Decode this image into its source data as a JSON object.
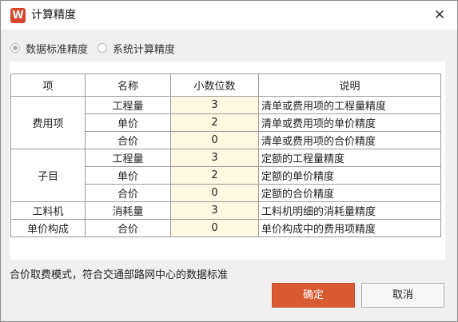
{
  "dialog": {
    "title": "计算精度",
    "app_icon_letter": "W",
    "close_glyph": "✕"
  },
  "options": [
    {
      "label": "数据标准精度",
      "checked": true
    },
    {
      "label": "系统计算精度",
      "checked": false
    }
  ],
  "table": {
    "headers": [
      "项",
      "名称",
      "小数位数",
      "说明"
    ],
    "groups": [
      {
        "item": "费用项",
        "rows": [
          {
            "name": "工程量",
            "digits": "3",
            "desc": "清单或费用项的工程量精度"
          },
          {
            "name": "单价",
            "digits": "2",
            "desc": "清单或费用项的单价精度"
          },
          {
            "name": "合价",
            "digits": "0",
            "desc": "清单或费用项的合价精度"
          }
        ]
      },
      {
        "item": "子目",
        "rows": [
          {
            "name": "工程量",
            "digits": "3",
            "desc": "定额的工程量精度"
          },
          {
            "name": "单价",
            "digits": "2",
            "desc": "定额的单价精度"
          },
          {
            "name": "合价",
            "digits": "0",
            "desc": "定额的合价精度"
          }
        ]
      },
      {
        "item": "工料机",
        "rows": [
          {
            "name": "消耗量",
            "digits": "3",
            "desc": "工料机明细的消耗量精度"
          }
        ]
      },
      {
        "item": "单价构成",
        "rows": [
          {
            "name": "合价",
            "digits": "0",
            "desc": "单价构成中的费用项精度"
          }
        ]
      }
    ]
  },
  "footer_note": "合价取费模式，符合交通部路网中心的数据标准",
  "buttons": {
    "ok": "确定",
    "cancel": "取消"
  },
  "colors": {
    "accent": "#d75a30",
    "digits_cell": "#fdf8e1"
  }
}
